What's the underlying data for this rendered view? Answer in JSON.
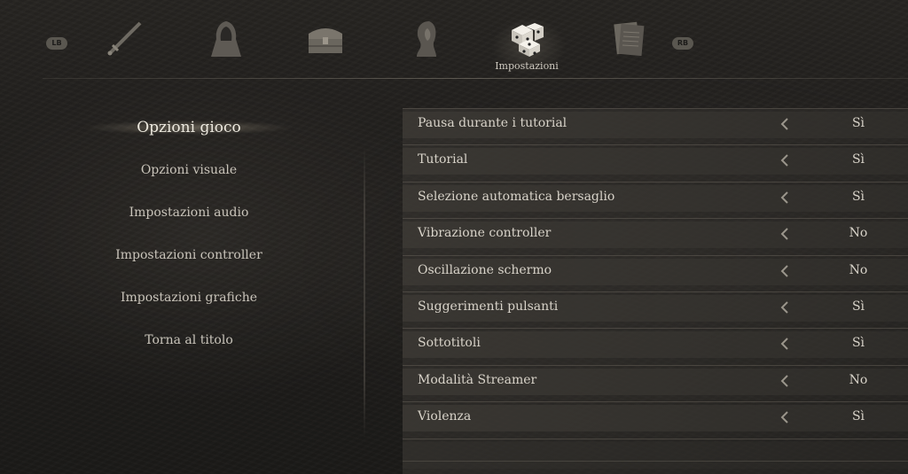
{
  "topbar": {
    "left_bumper": "LB",
    "right_bumper": "RB",
    "tabs": [
      {
        "icon": "sword-icon"
      },
      {
        "icon": "hooded-figure-icon"
      },
      {
        "icon": "chest-icon"
      },
      {
        "icon": "portrait-icon"
      },
      {
        "icon": "dice-icon",
        "label": "Impostazioni",
        "active": true
      },
      {
        "icon": "documents-icon"
      }
    ]
  },
  "menu": {
    "items": [
      {
        "label": "Opzioni gioco",
        "active": true
      },
      {
        "label": "Opzioni visuale"
      },
      {
        "label": "Impostazioni audio"
      },
      {
        "label": "Impostazioni controller"
      },
      {
        "label": "Impostazioni grafiche"
      },
      {
        "label": "Torna al titolo"
      }
    ]
  },
  "settings": {
    "rows": [
      {
        "label": "Pausa durante i tutorial",
        "value": "Sì"
      },
      {
        "label": "Tutorial",
        "value": "Sì"
      },
      {
        "label": "Selezione automatica bersaglio",
        "value": "Sì"
      },
      {
        "label": "Vibrazione controller",
        "value": "No"
      },
      {
        "label": "Oscillazione schermo",
        "value": "No"
      },
      {
        "label": "Suggerimenti pulsanti",
        "value": "Sì"
      },
      {
        "label": "Sottotitoli",
        "value": "Sì"
      },
      {
        "label": "Modalità Streamer",
        "value": "No"
      },
      {
        "label": "Violenza",
        "value": "Sì"
      }
    ]
  },
  "colors": {
    "text": "#d6d2c8",
    "row_bg": "#3a3733",
    "bumper_bg": "#5a5750"
  }
}
